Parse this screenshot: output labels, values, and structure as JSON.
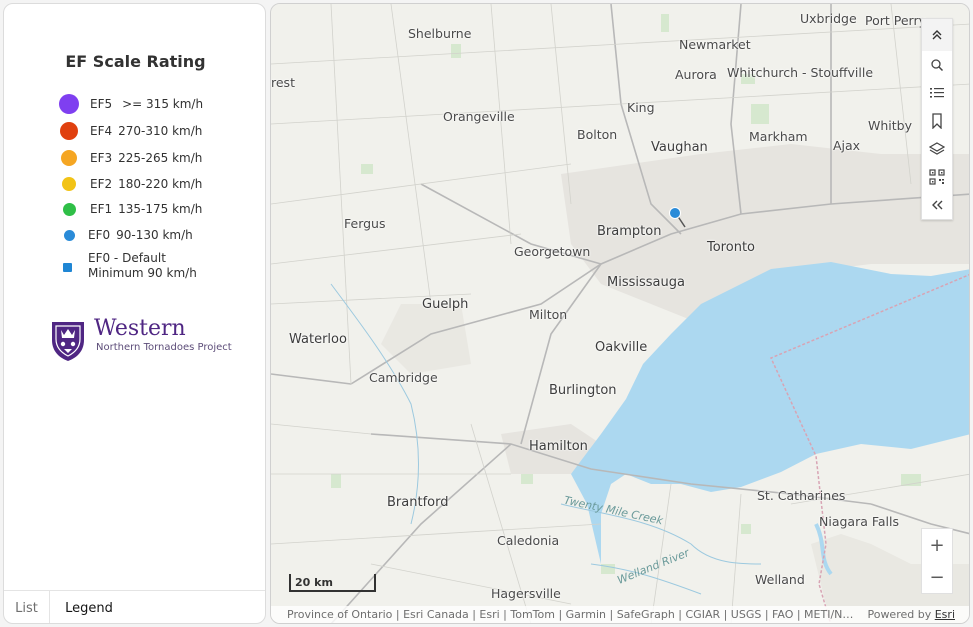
{
  "legend": {
    "title": "EF Scale Rating",
    "items": [
      {
        "label": "EF5",
        "range": ">= 315 km/h",
        "color": "#7f3ff0",
        "shape": "circle"
      },
      {
        "label": "EF4",
        "range": "270-310 km/h",
        "color": "#e0400f",
        "shape": "circle"
      },
      {
        "label": "EF3",
        "range": "225-265 km/h",
        "color": "#f5a623",
        "shape": "circle"
      },
      {
        "label": "EF2",
        "range": "180-220 km/h",
        "color": "#f2c316",
        "shape": "circle"
      },
      {
        "label": "EF1",
        "range": "135-175 km/h",
        "color": "#2fbf47",
        "shape": "circle"
      },
      {
        "label": "EF0",
        "range": "90-130 km/h",
        "color": "#2a8bd8",
        "shape": "circle"
      },
      {
        "label": "EF0 - Default",
        "range": "Minimum 90 km/h",
        "color": "#1f86d4",
        "shape": "square"
      }
    ]
  },
  "logo": {
    "wordmark": "Western",
    "subtitle": "Northern Tornadoes Project",
    "color": "#4f2683"
  },
  "tabs": [
    {
      "label": "List",
      "active": false
    },
    {
      "label": "Legend",
      "active": true
    }
  ],
  "map": {
    "places": {
      "uxbridge": "Uxbridge",
      "port_perry": "Port Perry",
      "shelburne": "Shelburne",
      "newmarket": "Newmarket",
      "aurora": "Aurora",
      "whitchurch": "Whitchurch - Stouffville",
      "forest": "rest",
      "orangeville": "Orangeville",
      "king": "King",
      "bolton": "Bolton",
      "markham": "Markham",
      "whitby": "Whitby",
      "vaughan": "Vaughan",
      "ajax": "Ajax",
      "fergus": "Fergus",
      "brampton": "Brampton",
      "georgetown": "Georgetown",
      "toronto": "Toronto",
      "mississauga": "Mississauga",
      "guelph": "Guelph",
      "milton": "Milton",
      "waterloo": "Waterloo",
      "oakville": "Oakville",
      "cambridge": "Cambridge",
      "burlington": "Burlington",
      "hamilton": "Hamilton",
      "brantford": "Brantford",
      "st_catharines": "St. Catharines",
      "niagara_falls": "Niagara Falls",
      "caledonia": "Caledonia",
      "welland": "Welland",
      "hagersville": "Hagersville",
      "twenty_mile_creek": "Twenty Mile Creek",
      "welland_river": "Welland River"
    },
    "scale_label": "20 km",
    "attribution": "Province of Ontario | Esri Canada | Esri | TomTom | Garmin | SafeGraph | CGIAR | USGS | FAO | METI/NASA",
    "powered_by": "Powered by",
    "esri_link": "Esri",
    "tools": [
      "collapse-icon",
      "search-icon",
      "list-icon",
      "bookmark-icon",
      "layers-icon",
      "qr-code-icon",
      "expand-left-icon"
    ],
    "zoom_in": "+",
    "zoom_out": "−",
    "marker_color": "#2a8bd8"
  }
}
